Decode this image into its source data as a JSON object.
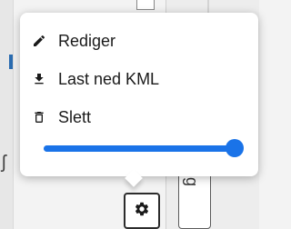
{
  "menu": {
    "items": [
      {
        "label": "Rediger",
        "icon": "pencil-icon"
      },
      {
        "label": "Last ned KML",
        "icon": "download-icon"
      },
      {
        "label": "Slett",
        "icon": "trash-icon"
      }
    ]
  },
  "opacity_slider": {
    "value": 0.97,
    "colors": {
      "fill": "#1a73e8",
      "track": "#b9d2f7"
    }
  },
  "settings_button": {
    "icon": "gear-icon"
  },
  "background": {
    "tab_label": "g",
    "left_fragment": "ʃ"
  }
}
